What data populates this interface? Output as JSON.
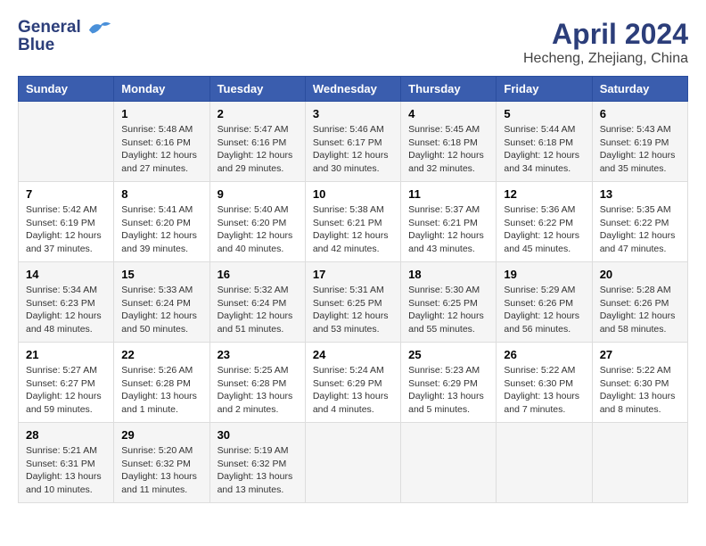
{
  "logo": {
    "line1": "General",
    "line2": "Blue"
  },
  "title": "April 2024",
  "subtitle": "Hecheng, Zhejiang, China",
  "weekdays": [
    "Sunday",
    "Monday",
    "Tuesday",
    "Wednesday",
    "Thursday",
    "Friday",
    "Saturday"
  ],
  "weeks": [
    [
      {
        "day": "",
        "info": ""
      },
      {
        "day": "1",
        "info": "Sunrise: 5:48 AM\nSunset: 6:16 PM\nDaylight: 12 hours\nand 27 minutes."
      },
      {
        "day": "2",
        "info": "Sunrise: 5:47 AM\nSunset: 6:16 PM\nDaylight: 12 hours\nand 29 minutes."
      },
      {
        "day": "3",
        "info": "Sunrise: 5:46 AM\nSunset: 6:17 PM\nDaylight: 12 hours\nand 30 minutes."
      },
      {
        "day": "4",
        "info": "Sunrise: 5:45 AM\nSunset: 6:18 PM\nDaylight: 12 hours\nand 32 minutes."
      },
      {
        "day": "5",
        "info": "Sunrise: 5:44 AM\nSunset: 6:18 PM\nDaylight: 12 hours\nand 34 minutes."
      },
      {
        "day": "6",
        "info": "Sunrise: 5:43 AM\nSunset: 6:19 PM\nDaylight: 12 hours\nand 35 minutes."
      }
    ],
    [
      {
        "day": "7",
        "info": "Sunrise: 5:42 AM\nSunset: 6:19 PM\nDaylight: 12 hours\nand 37 minutes."
      },
      {
        "day": "8",
        "info": "Sunrise: 5:41 AM\nSunset: 6:20 PM\nDaylight: 12 hours\nand 39 minutes."
      },
      {
        "day": "9",
        "info": "Sunrise: 5:40 AM\nSunset: 6:20 PM\nDaylight: 12 hours\nand 40 minutes."
      },
      {
        "day": "10",
        "info": "Sunrise: 5:38 AM\nSunset: 6:21 PM\nDaylight: 12 hours\nand 42 minutes."
      },
      {
        "day": "11",
        "info": "Sunrise: 5:37 AM\nSunset: 6:21 PM\nDaylight: 12 hours\nand 43 minutes."
      },
      {
        "day": "12",
        "info": "Sunrise: 5:36 AM\nSunset: 6:22 PM\nDaylight: 12 hours\nand 45 minutes."
      },
      {
        "day": "13",
        "info": "Sunrise: 5:35 AM\nSunset: 6:22 PM\nDaylight: 12 hours\nand 47 minutes."
      }
    ],
    [
      {
        "day": "14",
        "info": "Sunrise: 5:34 AM\nSunset: 6:23 PM\nDaylight: 12 hours\nand 48 minutes."
      },
      {
        "day": "15",
        "info": "Sunrise: 5:33 AM\nSunset: 6:24 PM\nDaylight: 12 hours\nand 50 minutes."
      },
      {
        "day": "16",
        "info": "Sunrise: 5:32 AM\nSunset: 6:24 PM\nDaylight: 12 hours\nand 51 minutes."
      },
      {
        "day": "17",
        "info": "Sunrise: 5:31 AM\nSunset: 6:25 PM\nDaylight: 12 hours\nand 53 minutes."
      },
      {
        "day": "18",
        "info": "Sunrise: 5:30 AM\nSunset: 6:25 PM\nDaylight: 12 hours\nand 55 minutes."
      },
      {
        "day": "19",
        "info": "Sunrise: 5:29 AM\nSunset: 6:26 PM\nDaylight: 12 hours\nand 56 minutes."
      },
      {
        "day": "20",
        "info": "Sunrise: 5:28 AM\nSunset: 6:26 PM\nDaylight: 12 hours\nand 58 minutes."
      }
    ],
    [
      {
        "day": "21",
        "info": "Sunrise: 5:27 AM\nSunset: 6:27 PM\nDaylight: 12 hours\nand 59 minutes."
      },
      {
        "day": "22",
        "info": "Sunrise: 5:26 AM\nSunset: 6:28 PM\nDaylight: 13 hours\nand 1 minute."
      },
      {
        "day": "23",
        "info": "Sunrise: 5:25 AM\nSunset: 6:28 PM\nDaylight: 13 hours\nand 2 minutes."
      },
      {
        "day": "24",
        "info": "Sunrise: 5:24 AM\nSunset: 6:29 PM\nDaylight: 13 hours\nand 4 minutes."
      },
      {
        "day": "25",
        "info": "Sunrise: 5:23 AM\nSunset: 6:29 PM\nDaylight: 13 hours\nand 5 minutes."
      },
      {
        "day": "26",
        "info": "Sunrise: 5:22 AM\nSunset: 6:30 PM\nDaylight: 13 hours\nand 7 minutes."
      },
      {
        "day": "27",
        "info": "Sunrise: 5:22 AM\nSunset: 6:30 PM\nDaylight: 13 hours\nand 8 minutes."
      }
    ],
    [
      {
        "day": "28",
        "info": "Sunrise: 5:21 AM\nSunset: 6:31 PM\nDaylight: 13 hours\nand 10 minutes."
      },
      {
        "day": "29",
        "info": "Sunrise: 5:20 AM\nSunset: 6:32 PM\nDaylight: 13 hours\nand 11 minutes."
      },
      {
        "day": "30",
        "info": "Sunrise: 5:19 AM\nSunset: 6:32 PM\nDaylight: 13 hours\nand 13 minutes."
      },
      {
        "day": "",
        "info": ""
      },
      {
        "day": "",
        "info": ""
      },
      {
        "day": "",
        "info": ""
      },
      {
        "day": "",
        "info": ""
      }
    ]
  ]
}
